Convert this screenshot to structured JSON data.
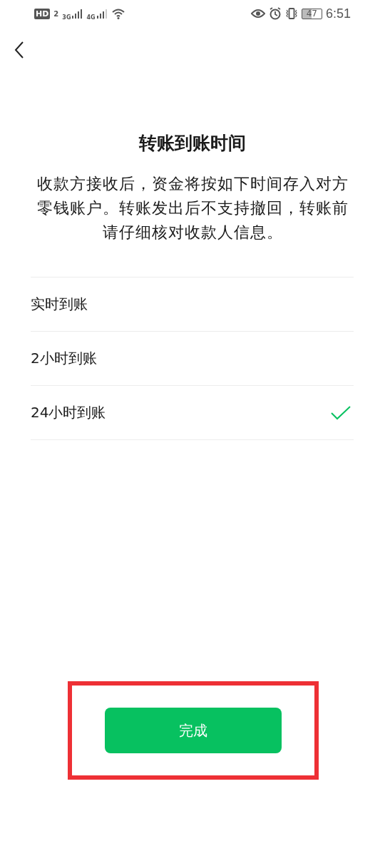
{
  "status_bar": {
    "hd": "HD",
    "sim": "2",
    "network_1": "3G",
    "network_2": "4G",
    "battery": "47",
    "time": "6:51"
  },
  "title": "转账到账时间",
  "description": "收款方接收后，资金将按如下时间存入对方零钱账户。转账发出后不支持撤回，转账前请仔细核对收款人信息。",
  "options": [
    {
      "label": "实时到账",
      "selected": false
    },
    {
      "label": "2小时到账",
      "selected": false
    },
    {
      "label": "24小时到账",
      "selected": true
    }
  ],
  "done_button": "完成",
  "highlight": true
}
